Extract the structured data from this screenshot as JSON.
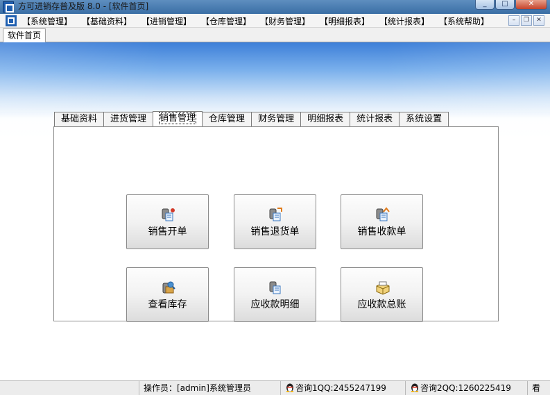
{
  "window": {
    "title": "方可进销存普及版 8.0 - [软件首页]"
  },
  "menubar": {
    "items": [
      "【系统管理】",
      "【基础资料】",
      "【进销管理】",
      "【仓库管理】",
      "【财务管理】",
      "【明细报表】",
      "【统计报表】",
      "【系统帮助】"
    ]
  },
  "doc_tabs": {
    "active": "软件首页"
  },
  "func_tabs": [
    "基础资料",
    "进货管理",
    "销售管理",
    "仓库管理",
    "财务管理",
    "明细报表",
    "统计报表",
    "系统设置"
  ],
  "active_func_tab": "销售管理",
  "actions": [
    {
      "label": "销售开单",
      "icon": "sales-order-icon"
    },
    {
      "label": "销售退货单",
      "icon": "sales-return-icon"
    },
    {
      "label": "销售收款单",
      "icon": "sales-receipt-icon"
    },
    {
      "label": "查看库存",
      "icon": "inventory-icon"
    },
    {
      "label": "应收款明细",
      "icon": "receivable-detail-icon"
    },
    {
      "label": "应收款总账",
      "icon": "receivable-ledger-icon"
    }
  ],
  "statusbar": {
    "operator": "操作员：[admin]系统管理员",
    "qq1": "咨询1QQ:2455247199",
    "qq2": "咨询2QQ:1260225419",
    "extra": "看"
  },
  "colors": {
    "title_bar": "#3a6ea5",
    "banner_blue": "#3d7fd8",
    "close_button": "#c5432b"
  }
}
